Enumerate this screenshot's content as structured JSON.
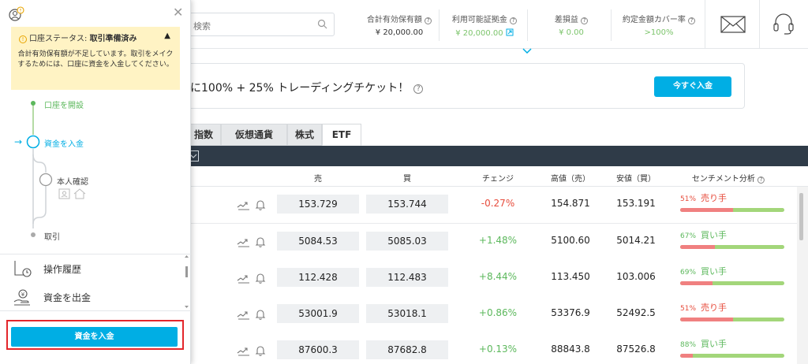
{
  "header": {
    "search_placeholder": "検索",
    "stats": [
      {
        "label": "合計有効保有額",
        "value": "¥ 20,000.00",
        "value_color": "#333333"
      },
      {
        "label": "利用可能証拠金",
        "value": "¥ 20,000.00",
        "value_color": "#7cc46b"
      },
      {
        "label": "差損益",
        "value": "¥ 0.00",
        "value_color": "#7cc46b"
      },
      {
        "label": "約定金額カバー率",
        "value": ">100%",
        "value_color": "#7cc46b"
      }
    ]
  },
  "promo": {
    "text": "に100% + 25% トレーディングチケット！",
    "button_label": "今すぐ入金"
  },
  "tabs": [
    "指数",
    "仮想通貨",
    "株式",
    "ETF"
  ],
  "table": {
    "headers": {
      "sell": "売",
      "buy": "買",
      "change": "チェンジ",
      "high": "高値（売）",
      "low": "安値（買）",
      "sentiment": "センチメント分析"
    },
    "rows": [
      {
        "sell": "153.729",
        "buy": "153.744",
        "change": "-0.27%",
        "high": "154.871",
        "low": "153.191",
        "sentiment_pct": "51%",
        "sentiment_label": "売り手",
        "sentiment_share": 0.51,
        "sentiment_side": "sell"
      },
      {
        "sell": "5084.53",
        "buy": "5085.03",
        "change": "+1.48%",
        "high": "5100.60",
        "low": "5014.21",
        "sentiment_pct": "67%",
        "sentiment_label": "買い手",
        "sentiment_share": 0.33,
        "sentiment_side": "buy"
      },
      {
        "sell": "112.428",
        "buy": "112.483",
        "change": "+8.44%",
        "high": "113.450",
        "low": "103.006",
        "sentiment_pct": "69%",
        "sentiment_label": "買い手",
        "sentiment_share": 0.31,
        "sentiment_side": "buy"
      },
      {
        "sell": "53001.9",
        "buy": "53018.1",
        "change": "+0.86%",
        "high": "53376.9",
        "low": "52492.5",
        "sentiment_pct": "51%",
        "sentiment_label": "売り手",
        "sentiment_share": 0.51,
        "sentiment_side": "sell"
      },
      {
        "sell": "87600.3",
        "buy": "87682.8",
        "change": "+0.13%",
        "high": "88843.8",
        "low": "87526.8",
        "sentiment_pct": "88%",
        "sentiment_label": "買い手",
        "sentiment_share": 0.12,
        "sentiment_side": "buy"
      }
    ]
  },
  "side_panel": {
    "status_label": "口座ステータス:",
    "status_value": "取引準備済み",
    "status_message": "合計有効保有額が不足しています。取引をメイクするためには、口座に資金を入金してください。",
    "steps": {
      "open_account": "口座を開設",
      "deposit": "資金を入金",
      "verify": "本人確認",
      "trade": "取引"
    },
    "menu": [
      {
        "label": "操作履歴",
        "icon": "history-icon"
      },
      {
        "label": "資金を出金",
        "icon": "withdraw-icon"
      }
    ],
    "deposit_button": "資金を入金"
  },
  "colors": {
    "accent": "#00aee4",
    "positive": "#5cb85c",
    "negative": "#e74c3c",
    "highlight": "#e3262b"
  }
}
